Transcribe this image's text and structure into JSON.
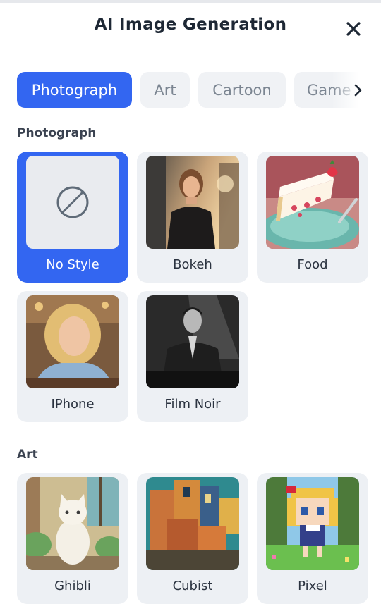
{
  "header": {
    "title": "AI Image Generation",
    "close_icon": "close-icon"
  },
  "tabs": [
    {
      "label": "Photograph",
      "active": true
    },
    {
      "label": "Art",
      "active": false
    },
    {
      "label": "Cartoon",
      "active": false
    },
    {
      "label": "Game",
      "active": false
    }
  ],
  "sections": {
    "photograph": {
      "title": "Photograph",
      "items": [
        {
          "label": "No Style",
          "selected": true,
          "icon": "no-style-icon"
        },
        {
          "label": "Bokeh"
        },
        {
          "label": "Food"
        },
        {
          "label": "IPhone"
        },
        {
          "label": "Film Noir"
        }
      ]
    },
    "art": {
      "title": "Art",
      "items": [
        {
          "label": "Ghibli"
        },
        {
          "label": "Cubist"
        },
        {
          "label": "Pixel"
        }
      ]
    }
  },
  "colors": {
    "accent": "#3366f1",
    "card_bg": "#edf0f4",
    "tab_bg": "#f0f2f5"
  }
}
